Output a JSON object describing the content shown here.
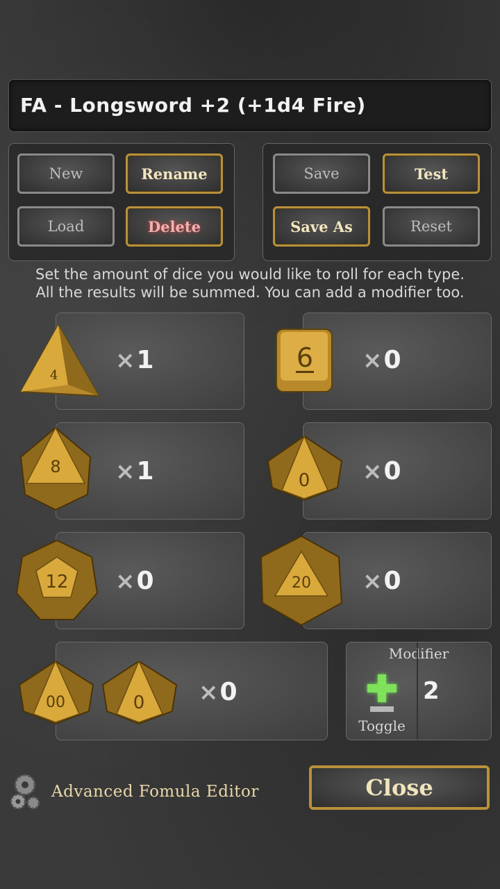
{
  "formula_name": "FA - Longsword +2 (+1d4 Fire)",
  "buttons": {
    "new": "New",
    "rename": "Rename",
    "load": "Load",
    "delete": "Delete",
    "save": "Save",
    "test": "Test",
    "save_as": "Save As",
    "reset": "Reset"
  },
  "instructions": {
    "line1": "Set the amount of dice you would like to roll for each type.",
    "line2": "All the results will be summed. You can add a modifier too."
  },
  "dice": {
    "d4": {
      "face": "4",
      "count": "1"
    },
    "d6": {
      "face": "6",
      "count": "0"
    },
    "d8": {
      "face": "8",
      "count": "1"
    },
    "d10": {
      "face": "0",
      "count": "0"
    },
    "d12": {
      "face": "12",
      "count": "0"
    },
    "d20": {
      "face": "20",
      "count": "0"
    },
    "d100": {
      "face_tens": "00",
      "face_units": "0",
      "count": "0"
    }
  },
  "count_prefix": "×",
  "modifier": {
    "label": "Modifier",
    "toggle_label": "Toggle",
    "value": "2",
    "sign": "plus"
  },
  "advanced_editor_label": "Advanced Fomula Editor",
  "close_label": "Close",
  "colors": {
    "gold_border": "#b8913a",
    "silver_border": "#8a8a8a",
    "die_gold": "#c99a2e",
    "toggle_green": "#7fe05a"
  }
}
